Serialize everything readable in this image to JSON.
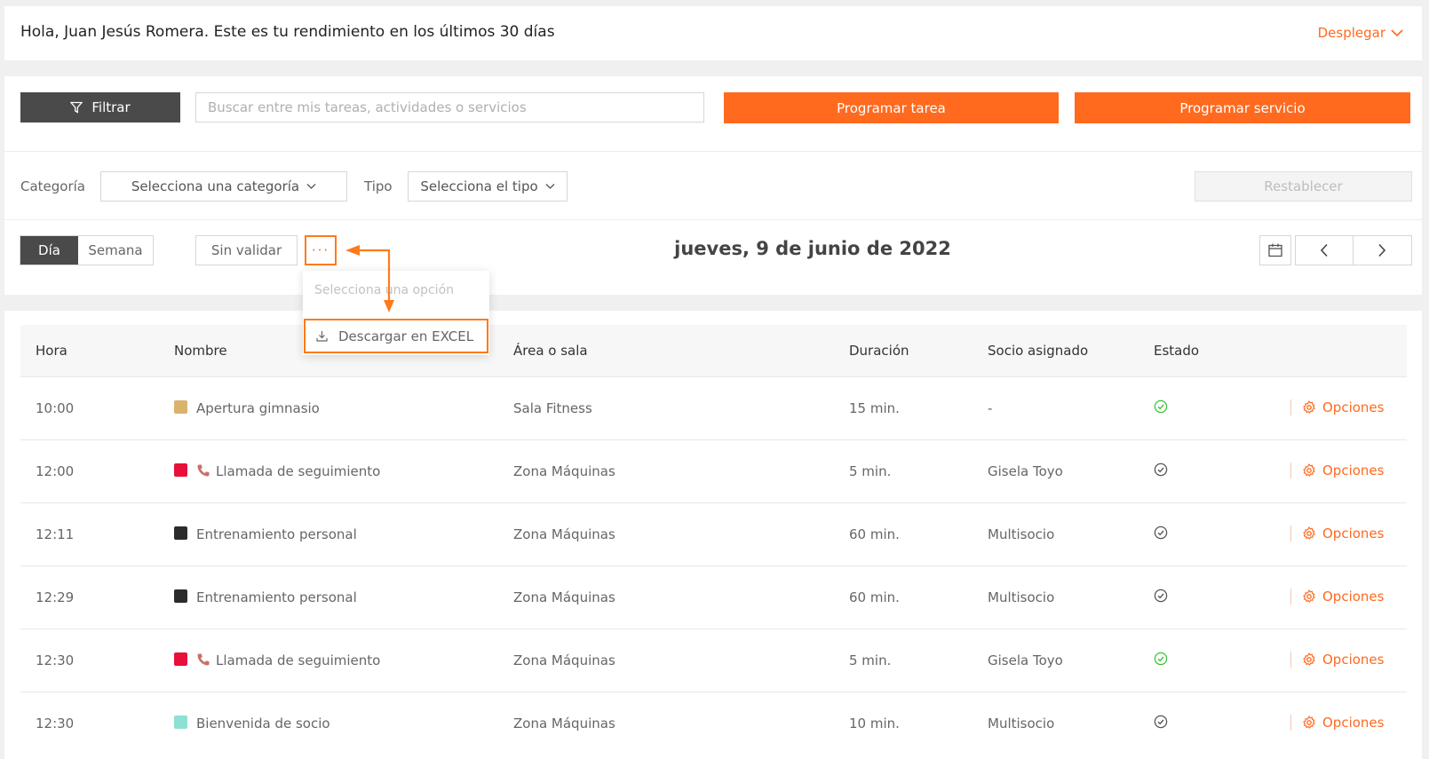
{
  "header": {
    "greeting": "Hola, Juan Jesús Romera. Este es tu rendimiento en los últimos 30 días",
    "expand_label": "Desplegar"
  },
  "toolbar": {
    "filter_label": "Filtrar",
    "search_placeholder": "Buscar entre mis tareas, actividades o servicios",
    "schedule_task": "Programar tarea",
    "schedule_service": "Programar servicio"
  },
  "filters": {
    "category_label": "Categoría",
    "category_select": "Selecciona una categoría",
    "type_label": "Tipo",
    "type_select": "Selecciona el tipo",
    "reset_label": "Restablecer"
  },
  "view": {
    "day": "Día",
    "week": "Semana",
    "unvalidated": "Sin validar",
    "more": "···",
    "date": "jueves, 9 de junio de 2022"
  },
  "dropdown": {
    "placeholder": "Selecciona una opción",
    "option": "Descargar en EXCEL"
  },
  "table": {
    "columns": [
      "Hora",
      "Nombre",
      "Área o sala",
      "Duración",
      "Socio asignado",
      "Estado"
    ],
    "options_label": "Opciones",
    "rows": [
      {
        "time": "10:00",
        "name": "Apertura gimnasio",
        "color": "#d9b36d",
        "phone": false,
        "area": "Sala Fitness",
        "duration": "15 min.",
        "member": "-",
        "status": "validated"
      },
      {
        "time": "12:00",
        "name": "Llamada de seguimiento",
        "color": "#e8103a",
        "phone": true,
        "area": "Zona Máquinas",
        "duration": "5 min.",
        "member": "Gisela Toyo",
        "status": "pending"
      },
      {
        "time": "12:11",
        "name": "Entrenamiento personal",
        "color": "#2b2b2b",
        "phone": false,
        "area": "Zona Máquinas",
        "duration": "60 min.",
        "member": "Multisocio",
        "status": "pending"
      },
      {
        "time": "12:29",
        "name": "Entrenamiento personal",
        "color": "#2b2b2b",
        "phone": false,
        "area": "Zona Máquinas",
        "duration": "60 min.",
        "member": "Multisocio",
        "status": "pending"
      },
      {
        "time": "12:30",
        "name": "Llamada de seguimiento",
        "color": "#e8103a",
        "phone": true,
        "area": "Zona Máquinas",
        "duration": "5 min.",
        "member": "Gisela Toyo",
        "status": "validated"
      },
      {
        "time": "12:30",
        "name": "Bienvenida de socio",
        "color": "#8de0d3",
        "phone": false,
        "area": "Zona Máquinas",
        "duration": "10 min.",
        "member": "Multisocio",
        "status": "pending"
      }
    ]
  },
  "colors": {
    "accent": "#ff6a1f",
    "dark": "#4a4a4a",
    "validated": "#3cc13c",
    "pending": "#555555"
  }
}
